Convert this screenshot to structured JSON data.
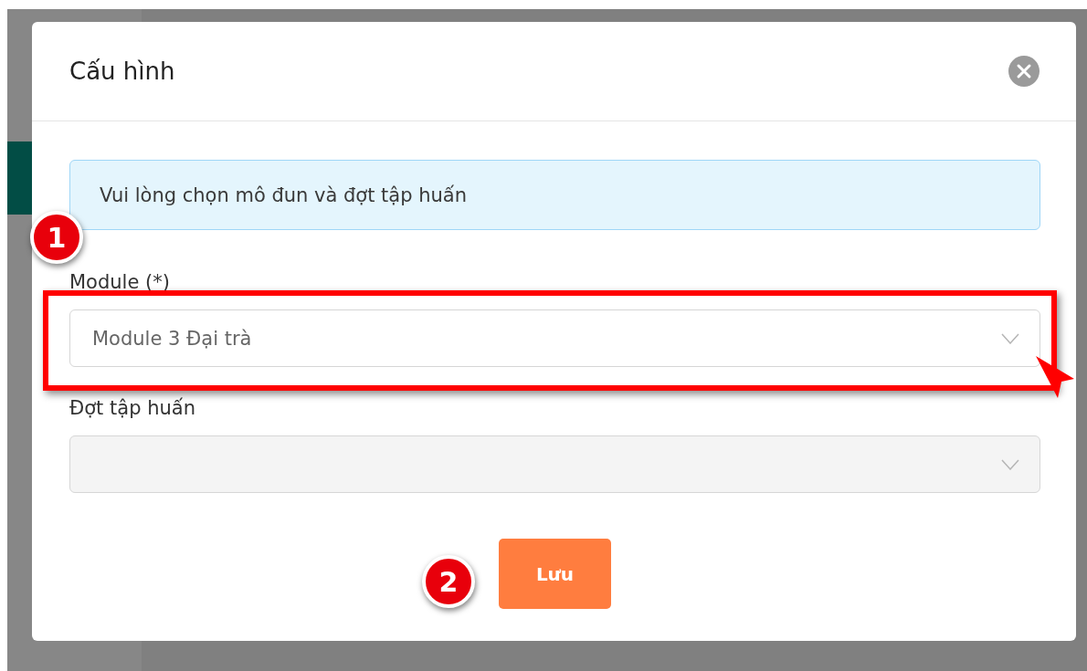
{
  "dialog": {
    "title": "Cấu hình",
    "alert": "Vui lòng chọn mô đun và đợt tập huấn",
    "fields": [
      {
        "label": "Module (*)",
        "value": "Module 3 Đại trà",
        "disabled": false
      },
      {
        "label": "Đợt tập huấn",
        "disabled": true
      }
    ],
    "save_button": "Lưu"
  },
  "annotations": [
    {
      "label": "1"
    },
    {
      "label": "2"
    }
  ]
}
